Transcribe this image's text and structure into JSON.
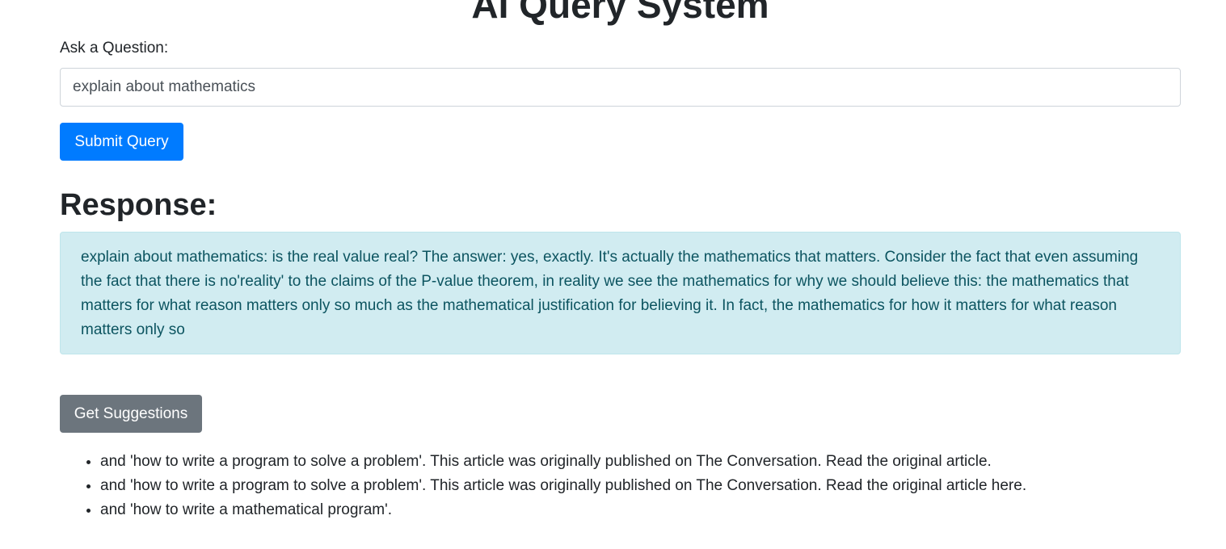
{
  "page": {
    "title": "AI Query System"
  },
  "query": {
    "label": "Ask a Question:",
    "value": "explain about mathematics",
    "submit_label": "Submit Query"
  },
  "response": {
    "heading": "Response:",
    "text": "explain about mathematics: is the real value real? The answer: yes, exactly. It's actually the mathematics that matters. Consider the fact that even assuming the fact that there is no'reality' to the claims of the P-value theorem, in reality we see the mathematics for why we should believe this: the mathematics that matters for what reason matters only so much as the mathematical justification for believing it. In fact, the mathematics for how it matters for what reason matters only so"
  },
  "suggestions": {
    "button_label": "Get Suggestions",
    "items": [
      "and 'how to write a program to solve a problem'. This article was originally published on The Conversation. Read the original article.",
      "and 'how to write a program to solve a problem'. This article was originally published on The Conversation. Read the original article here.",
      "and 'how to write a mathematical program'."
    ]
  }
}
